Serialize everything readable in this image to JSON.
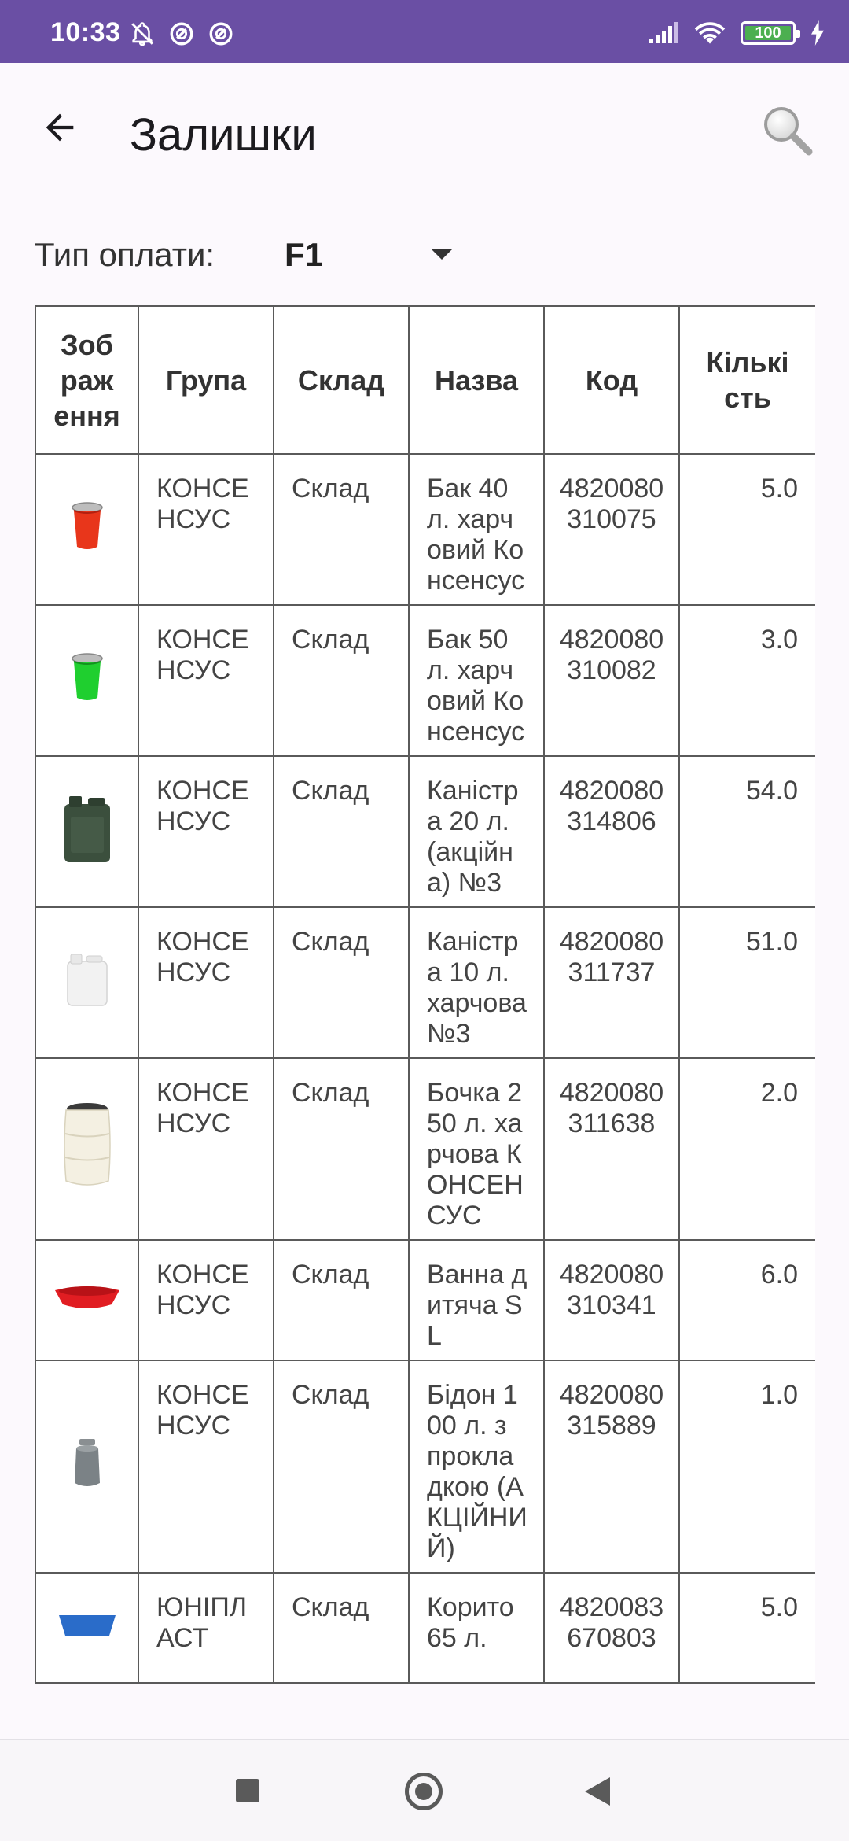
{
  "status_bar": {
    "time": "10:33",
    "battery": "100",
    "icons_left": [
      "bell-off-icon",
      "cellular-data-icon",
      "cellular-data-icon"
    ],
    "icons_right": [
      "signal-icon",
      "wifi-icon",
      "battery-icon",
      "charging-icon"
    ]
  },
  "app_bar": {
    "title": "Залишки",
    "back_icon": "arrow-left-icon",
    "search_icon": "search-icon"
  },
  "payment": {
    "label": "Тип оплати:",
    "value": "F1"
  },
  "table": {
    "headers": [
      "Зоб\nраж\nення",
      "Група",
      "Склад",
      "Назва",
      "Код",
      "Кількі\nсть"
    ],
    "rows": [
      {
        "image": "bucket-red",
        "group": "КОНСЕНСУС",
        "warehouse": "Склад",
        "name": "Бак 40 л. харчовий Консенсус",
        "code": "4820080310075",
        "qty": "5.0"
      },
      {
        "image": "bucket-green",
        "group": "КОНСЕНСУС",
        "warehouse": "Склад",
        "name": "Бак 50 л. харчовий Консенсус",
        "code": "4820080310082",
        "qty": "3.0"
      },
      {
        "image": "canister-dark-green",
        "group": "КОНСЕНСУС",
        "warehouse": "Склад",
        "name": "Каністра 20 л. (акційна) №3",
        "code": "4820080314806",
        "qty": "54.0"
      },
      {
        "image": "canister-white",
        "group": "КОНСЕНСУС",
        "warehouse": "Склад",
        "name": "Каністра 10 л. харчова №3",
        "code": "4820080311737",
        "qty": "51.0"
      },
      {
        "image": "barrel-white",
        "group": "КОНСЕНСУС",
        "warehouse": "Склад",
        "name": "Бочка 250 л. харчова КОНСЕНСУС",
        "code": "4820080311638",
        "qty": "2.0"
      },
      {
        "image": "baby-bath-red",
        "group": "КОНСЕНСУС",
        "warehouse": "Склад",
        "name": "Ванна дитяча SL",
        "code": "4820080310341",
        "qty": "6.0"
      },
      {
        "image": "milk-can-grey",
        "group": "КОНСЕНСУС",
        "warehouse": "Склад",
        "name": "Бідон 100 л. з прокладкою (АКЦІЙНИЙ)",
        "code": "4820080315889",
        "qty": "1.0"
      },
      {
        "image": "trough",
        "group": "ЮНІПЛАСТ",
        "warehouse": "Склад",
        "name": "Корито 65 л.",
        "code": "4820083670803",
        "qty": "5.0"
      }
    ]
  },
  "colors": {
    "status_bar": "#6a4fa4",
    "background": "#fcf9fd",
    "grid": "#5a5a5a"
  }
}
